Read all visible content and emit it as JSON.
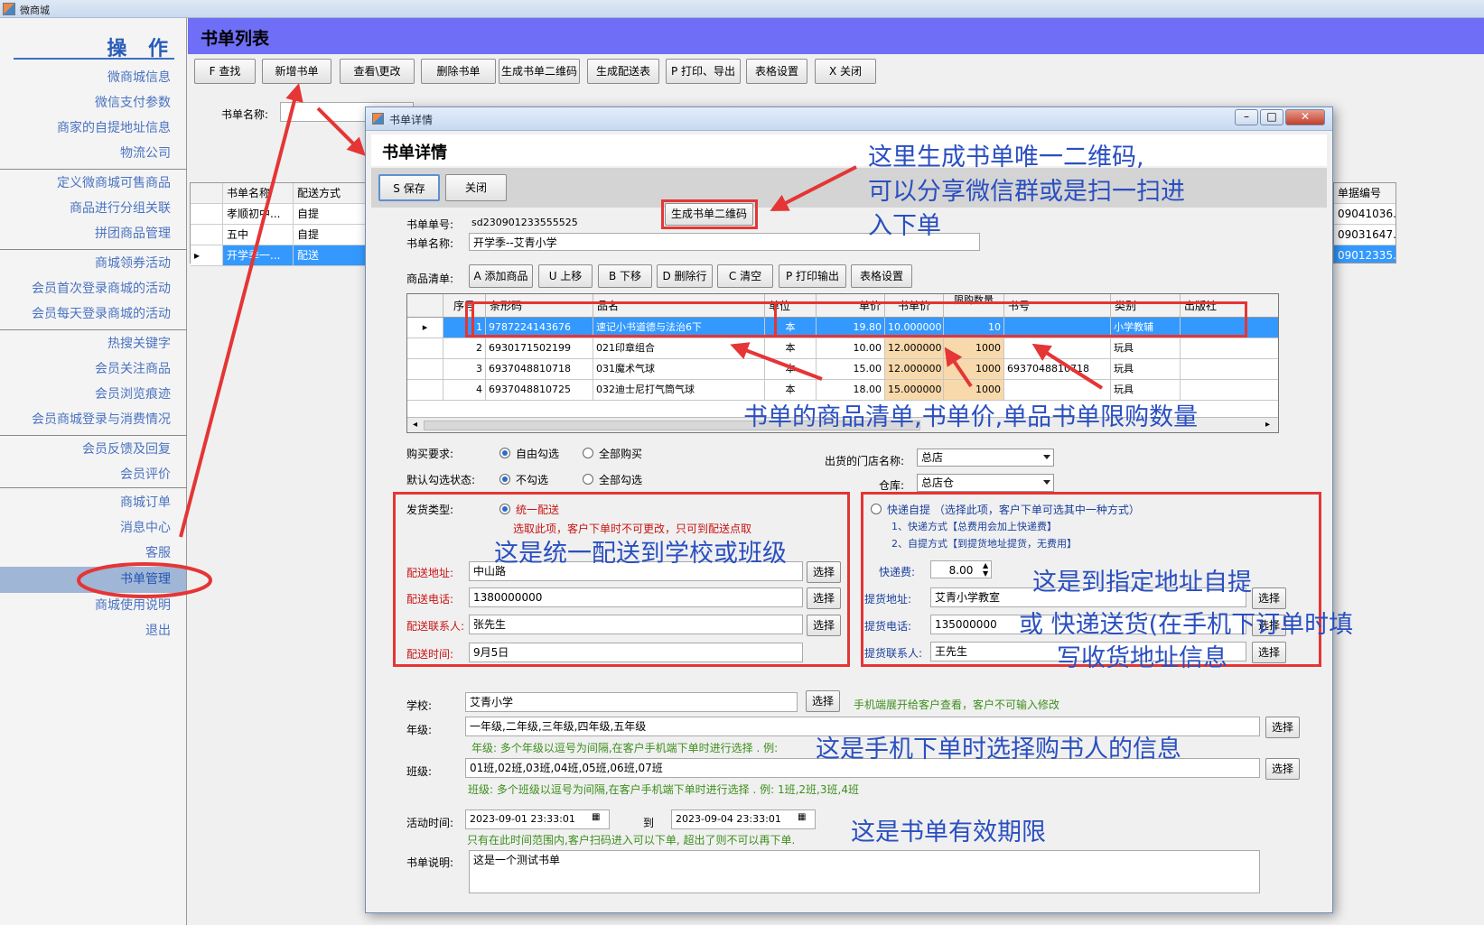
{
  "app": {
    "title": "微商城"
  },
  "sidebar": {
    "heading": "操  作",
    "items": [
      "微商城信息",
      "微信支付参数",
      "商家的自提地址信息",
      "物流公司",
      "定义微商城可售商品",
      "商品进行分组关联",
      "拼团商品管理",
      "商城领券活动",
      "会员首次登录商城的活动",
      "会员每天登录商城的活动",
      "热搜关键字",
      "会员关注商品",
      "会员浏览痕迹",
      "会员商城登录与消费情况",
      "会员反馈及回复",
      "会员评价",
      "商城订单",
      "消息中心",
      "客服",
      "书单管理",
      "商城使用说明",
      "退出"
    ]
  },
  "main": {
    "title": "书单列表",
    "toolbar": [
      "F 查找",
      "新增书单",
      "查看\\更改",
      "删除书单",
      "生成书单二维码",
      "生成配送表",
      "P 打印、导出",
      "表格设置",
      "X 关闭"
    ],
    "filter_label": "书单名称:",
    "list_headers": [
      "书单名称",
      "配送方式"
    ],
    "list_rows": [
      [
        "孝顺初中...",
        "自提"
      ],
      [
        "五中",
        "自提"
      ],
      [
        "开学季一...",
        "配送"
      ]
    ],
    "right_header": "单据编号",
    "right_values": [
      "09041036...",
      "09031647...",
      "09012335..."
    ]
  },
  "dialog": {
    "window_title": "书单详情",
    "heading": "书单详情",
    "save_label": "S 保存",
    "close_label": "关闭",
    "order_no_label": "书单单号:",
    "order_no": "sd230901233555525",
    "qr_button": "生成书单二维码",
    "name_label": "书单名称:",
    "name_value": "开学季--艾青小学",
    "goods_label": "商品清单:",
    "goods_toolbar": [
      "A 添加商品",
      "U 上移",
      "B 下移",
      "D 删除行",
      "C 清空",
      "P 打印输出",
      "表格设置"
    ],
    "grid_headers": [
      "序号",
      "条形码",
      "品名",
      "单位",
      "单价",
      "书单价",
      "限购数量",
      "书号",
      "类别",
      "出版社"
    ],
    "grid_rows": [
      [
        "1",
        "9787224143676",
        "速记小书道德与法治6下",
        "本",
        "19.80",
        "10.000000",
        "10",
        "",
        "小学教辅",
        ""
      ],
      [
        "2",
        "6930171502199",
        "021印章组合",
        "本",
        "10.00",
        "12.000000",
        "1000",
        "",
        "玩具",
        ""
      ],
      [
        "3",
        "6937048810718",
        "031魔术气球",
        "本",
        "15.00",
        "12.000000",
        "1000",
        "6937048810718",
        "玩具",
        ""
      ],
      [
        "4",
        "6937048810725",
        "032迪士尼打气筒气球",
        "本",
        "18.00",
        "15.000000",
        "1000",
        "",
        "玩具",
        ""
      ]
    ],
    "buy_req_label": "购买要求:",
    "buy_req_options": [
      "自由勾选",
      "全部购买"
    ],
    "default_check_label": "默认勾选状态:",
    "default_check_options": [
      "不勾选",
      "全部勾选"
    ],
    "store_label": "出货的门店名称:",
    "store_value": "总店",
    "warehouse_label": "仓库:",
    "warehouse_value": "总店仓",
    "ship_type_label": "发货类型:",
    "ship_unified": "统一配送",
    "ship_unified_note": "选取此项，客户下单时不可更改，只可到配送点取",
    "deliv_addr_label": "配送地址:",
    "deliv_addr": "中山路",
    "deliv_phone_label": "配送电话:",
    "deliv_phone": "1380000000",
    "deliv_contact_label": "配送联系人:",
    "deliv_contact": "张先生",
    "deliv_time_label": "配送时间:",
    "deliv_time": "9月5日",
    "select_label": "选择",
    "express_option": "快递自提 （选择此项，客户下单可选其中一种方式）",
    "express_note1": "1、快递方式【总费用会加上快递费】",
    "express_note2": "2、自提方式【到提货地址提货，无费用】",
    "express_fee_label": "快递费:",
    "express_fee": "8.00",
    "pickup_addr_label": "提货地址:",
    "pickup_addr": "艾青小学教室",
    "pickup_phone_label": "提货电话:",
    "pickup_phone": "135000000",
    "pickup_contact_label": "提货联系人:",
    "pickup_contact": "王先生",
    "school_label": "学校:",
    "school_value": "艾青小学",
    "school_note": "手机端展开给客户查看，客户不可输入修改",
    "grade_label": "年级:",
    "grade_value": "一年级,二年级,三年级,四年级,五年级",
    "grade_note": "年级:  多个年级以逗号为间隔,在客户手机端下单时进行选择 .      例:",
    "class_label": "班级:",
    "class_value": "01班,02班,03班,04班,05班,06班,07班",
    "class_note": "班级:  多个班级以逗号为间隔,在客户手机端下单时进行选择 .      例:   1班,2班,3班,4班",
    "period_label": "活动时间:",
    "period_start": "2023-09-01  23:33:01",
    "period_to": "到",
    "period_end": "2023-09-04  23:33:01",
    "period_note": "只有在此时间范围内,客户扫码进入可以下单,  超出了则不可以再下单.",
    "desc_label": "书单说明:",
    "desc_value": "这是一个测试书单"
  },
  "annotations": {
    "qr": [
      "这里生成书单唯一二维码,",
      "可以分享微信群或是扫一扫进",
      "入下单"
    ],
    "goods": "书单的商品清单,书单价,单品书单限购数量",
    "unified": "这是统一配送到学校或班级",
    "pickup": [
      "这是到指定地址自提",
      "或 快递送货(在手机下订单时填",
      "写收货地址信息"
    ],
    "buyer": "这是手机下单时选择购书人的信息",
    "validity": "这是书单有效期限"
  },
  "colors": {
    "header": "#6e6ef6",
    "highlight": "#3399ff",
    "annotation_red": "#e53535",
    "annotation_blue": "#2a4fc0"
  }
}
